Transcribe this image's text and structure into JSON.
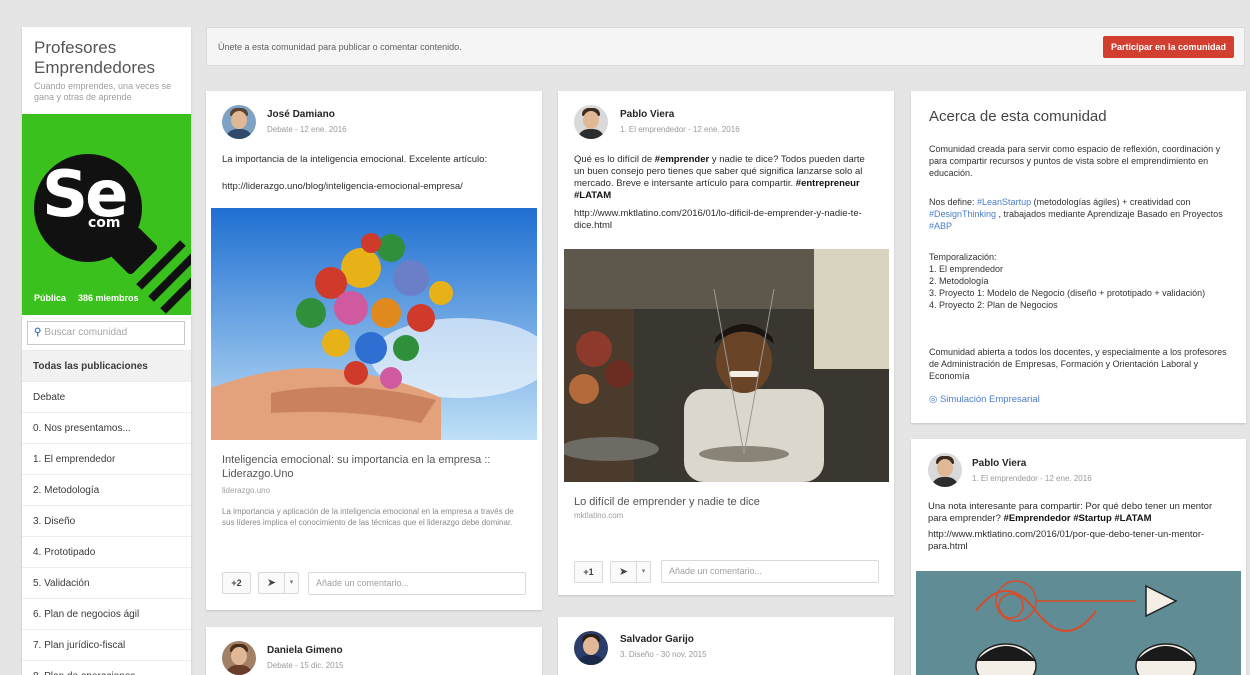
{
  "sidebar": {
    "title": "Profesores Emprendedores",
    "tagline": "Cuando emprendes, una veces se gana y otras de aprende",
    "cover_visibility": "Pública",
    "cover_members": "386 miembros",
    "search_placeholder": "Buscar comunidad",
    "nav": [
      {
        "label": "Todas las publicaciones",
        "active": true
      },
      {
        "label": "Debate"
      },
      {
        "label": "0. Nos presentamos..."
      },
      {
        "label": "1. El emprendedor"
      },
      {
        "label": "2. Metodología"
      },
      {
        "label": "3. Diseño"
      },
      {
        "label": "4. Prototipado"
      },
      {
        "label": "5. Validación"
      },
      {
        "label": "6. Plan de negocios ágil"
      },
      {
        "label": "7. Plan jurídico-fiscal"
      },
      {
        "label": "8. Plan de operaciones"
      }
    ]
  },
  "banner": {
    "text": "Únete a esta comunidad para publicar o comentar contenido.",
    "join_label": "Participar en la comunidad"
  },
  "posts": {
    "p1": {
      "author": "José Damiano",
      "meta": "Debate  -  12 ene. 2016",
      "text": "La importancia de la inteligencia emocional. Excelente artículo:",
      "url": "http://liderazgo.uno/blog/inteligencia-emocional-empresa/",
      "link_title": "Inteligencia emocional: su importancia en la empresa :: Liderazgo.Uno",
      "link_domain": "liderazgo.uno",
      "link_desc": "La importancia y aplicación de la inteligencia emocional en la empresa a través de sus líderes implica el conocimiento de las técnicas que el liderazgo debe dominar.",
      "plus": "+2",
      "comment_placeholder": "Añade un comentario..."
    },
    "p2": {
      "author": "Pablo Viera",
      "meta": "1. El emprendedor  -  12 ene. 2016",
      "text_1": "Qué es lo difícil de ",
      "text_bold_1": "#emprender",
      "text_2": " y nadie te dice? Todos pueden darte un buen consejo pero tienes que saber qué significa lanzarse solo al mercado. Breve e intersante artículo para compartir. ",
      "text_bold_2": "#entrepreneur #LATAM",
      "url": "http://www.mktlatino.com/2016/01/lo-dificil-de-emprender-y-nadie-te-dice.html",
      "link_title": "Lo difícil de emprender y nadie te dice",
      "link_domain": "mktlatino.com",
      "plus": "+1",
      "comment_placeholder": "Añade un comentario..."
    },
    "p3": {
      "author": "Daniela Gimeno",
      "meta": "Debate  -  15 dic. 2015"
    },
    "p4": {
      "author": "Salvador Garijo",
      "meta": "3. Diseño  -  30 nov. 2015"
    },
    "p5": {
      "author": "Pablo Viera",
      "meta": "1. El emprendedor  -  12 ene. 2016",
      "text_1": "Una nota interesante para compartir: Por qué debo tener un mentor para emprender? ",
      "text_bold": "#Emprendedor #Startup #LATAM",
      "url": "http://www.mktlatino.com/2016/01/por-que-debo-tener-un-mentor-para.html"
    }
  },
  "about": {
    "title": "Acerca de esta comunidad",
    "p1": "Comunidad creada para servir como espacio de reflexión, coordinación y para compartir recursos y puntos de vista sobre el emprendimiento en educación.",
    "p2_a": "Nos define: ",
    "p2_tag1": "#LeanStartup",
    "p2_b": " (metodologías ágiles) + creatividad con ",
    "p2_tag2": "#DesignThinking",
    "p2_c": " , trabajados mediante Aprendizaje Basado en Proyectos ",
    "p2_tag3": "#ABP",
    "p3_heading": "Temporalización:",
    "p3_items": [
      "1. El emprendedor",
      "2. Metodología",
      "3. Proyecto 1: Modelo de Negocio (diseño + prototipado + validación)",
      "4. Proyecto 2: Plan de Negocios"
    ],
    "p4": "Comunidad abierta a todos los docentes, y especialmente a los profesores de Administración de Empresas, Formación y Orientación Laboral y Economía",
    "link": "Simulación Empresarial"
  },
  "colors": {
    "accent_red": "#d23f31",
    "link_blue": "#4a7cc9",
    "cover_green": "#3bc11e"
  }
}
